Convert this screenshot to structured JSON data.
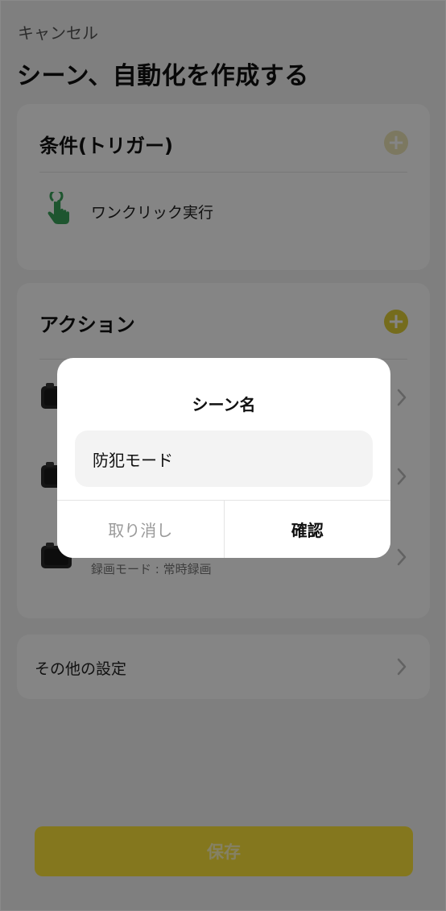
{
  "header": {
    "cancel_label": "キャンセル",
    "title": "シーン、自動化を作成する"
  },
  "trigger_card": {
    "heading": "条件(トリガー)",
    "add_icon": "plus-icon",
    "item": {
      "icon": "tap-hand-icon",
      "label": "ワンクリック実行"
    }
  },
  "action_card": {
    "heading": "アクション",
    "add_icon": "plus-icon",
    "devices": [
      {
        "icon": "camera-device-icon"
      },
      {
        "icon": "camera-device-icon"
      },
      {
        "icon": "camera-device-icon",
        "subtitle": "録画モード : 常時録画"
      }
    ]
  },
  "other_settings": {
    "label": "その他の設定"
  },
  "footer": {
    "save_label": "保存"
  },
  "dialog": {
    "title": "シーン名",
    "input_value": "防犯モード",
    "cancel_label": "取り消し",
    "confirm_label": "確認"
  },
  "colors": {
    "accent": "#fde53a",
    "accent_plus": "#e0cf38",
    "overlay": "rgba(0,0,0,0.48)",
    "tap_icon": "#3aa45a"
  }
}
